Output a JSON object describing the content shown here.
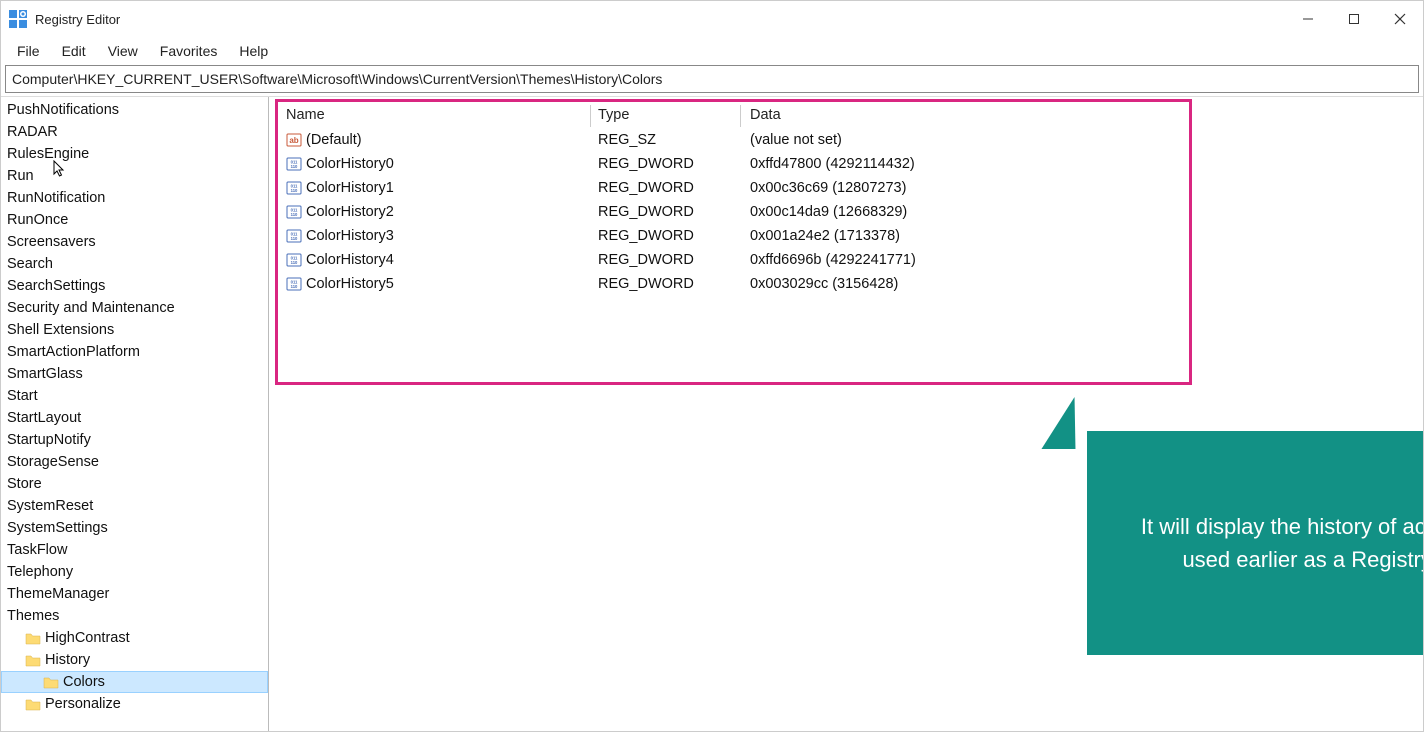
{
  "window": {
    "title": "Registry Editor"
  },
  "menu": {
    "items": [
      "File",
      "Edit",
      "View",
      "Favorites",
      "Help"
    ]
  },
  "address": "Computer\\HKEY_CURRENT_USER\\Software\\Microsoft\\Windows\\CurrentVersion\\Themes\\History\\Colors",
  "tree": [
    {
      "label": "PushNotifications",
      "indent": 1,
      "folder": false
    },
    {
      "label": "RADAR",
      "indent": 1,
      "folder": false
    },
    {
      "label": "RulesEngine",
      "indent": 1,
      "folder": false
    },
    {
      "label": "Run",
      "indent": 1,
      "folder": false
    },
    {
      "label": "RunNotification",
      "indent": 1,
      "folder": false
    },
    {
      "label": "RunOnce",
      "indent": 1,
      "folder": false
    },
    {
      "label": "Screensavers",
      "indent": 1,
      "folder": false
    },
    {
      "label": "Search",
      "indent": 1,
      "folder": false
    },
    {
      "label": "SearchSettings",
      "indent": 1,
      "folder": false
    },
    {
      "label": "Security and Maintenance",
      "indent": 1,
      "folder": false
    },
    {
      "label": "Shell Extensions",
      "indent": 1,
      "folder": false
    },
    {
      "label": "SmartActionPlatform",
      "indent": 1,
      "folder": false
    },
    {
      "label": "SmartGlass",
      "indent": 1,
      "folder": false
    },
    {
      "label": "Start",
      "indent": 1,
      "folder": false
    },
    {
      "label": "StartLayout",
      "indent": 1,
      "folder": false
    },
    {
      "label": "StartupNotify",
      "indent": 1,
      "folder": false
    },
    {
      "label": "StorageSense",
      "indent": 1,
      "folder": false
    },
    {
      "label": "Store",
      "indent": 1,
      "folder": false
    },
    {
      "label": "SystemReset",
      "indent": 1,
      "folder": false
    },
    {
      "label": "SystemSettings",
      "indent": 1,
      "folder": false
    },
    {
      "label": "TaskFlow",
      "indent": 1,
      "folder": false
    },
    {
      "label": "Telephony",
      "indent": 1,
      "folder": false
    },
    {
      "label": "ThemeManager",
      "indent": 1,
      "folder": false
    },
    {
      "label": "Themes",
      "indent": 1,
      "folder": false
    },
    {
      "label": "HighContrast",
      "indent": 2,
      "folder": true
    },
    {
      "label": "History",
      "indent": 2,
      "folder": true
    },
    {
      "label": "Colors",
      "indent": 3,
      "folder": true,
      "selected": true
    },
    {
      "label": "Personalize",
      "indent": 2,
      "folder": true
    }
  ],
  "columns": {
    "name": "Name",
    "type": "Type",
    "data": "Data"
  },
  "values": [
    {
      "name": "(Default)",
      "type": "REG_SZ",
      "data": "(value not set)",
      "icon": "sz"
    },
    {
      "name": "ColorHistory0",
      "type": "REG_DWORD",
      "data": "0xffd47800 (4292114432)",
      "icon": "dw"
    },
    {
      "name": "ColorHistory1",
      "type": "REG_DWORD",
      "data": "0x00c36c69 (12807273)",
      "icon": "dw"
    },
    {
      "name": "ColorHistory2",
      "type": "REG_DWORD",
      "data": "0x00c14da9 (12668329)",
      "icon": "dw"
    },
    {
      "name": "ColorHistory3",
      "type": "REG_DWORD",
      "data": "0x001a24e2 (1713378)",
      "icon": "dw"
    },
    {
      "name": "ColorHistory4",
      "type": "REG_DWORD",
      "data": "0xffd6696b (4292241771)",
      "icon": "dw"
    },
    {
      "name": "ColorHistory5",
      "type": "REG_DWORD",
      "data": "0x003029cc (3156428)",
      "icon": "dw"
    }
  ],
  "callout": "It will display the history of accent colors used earlier as a Registry Files."
}
